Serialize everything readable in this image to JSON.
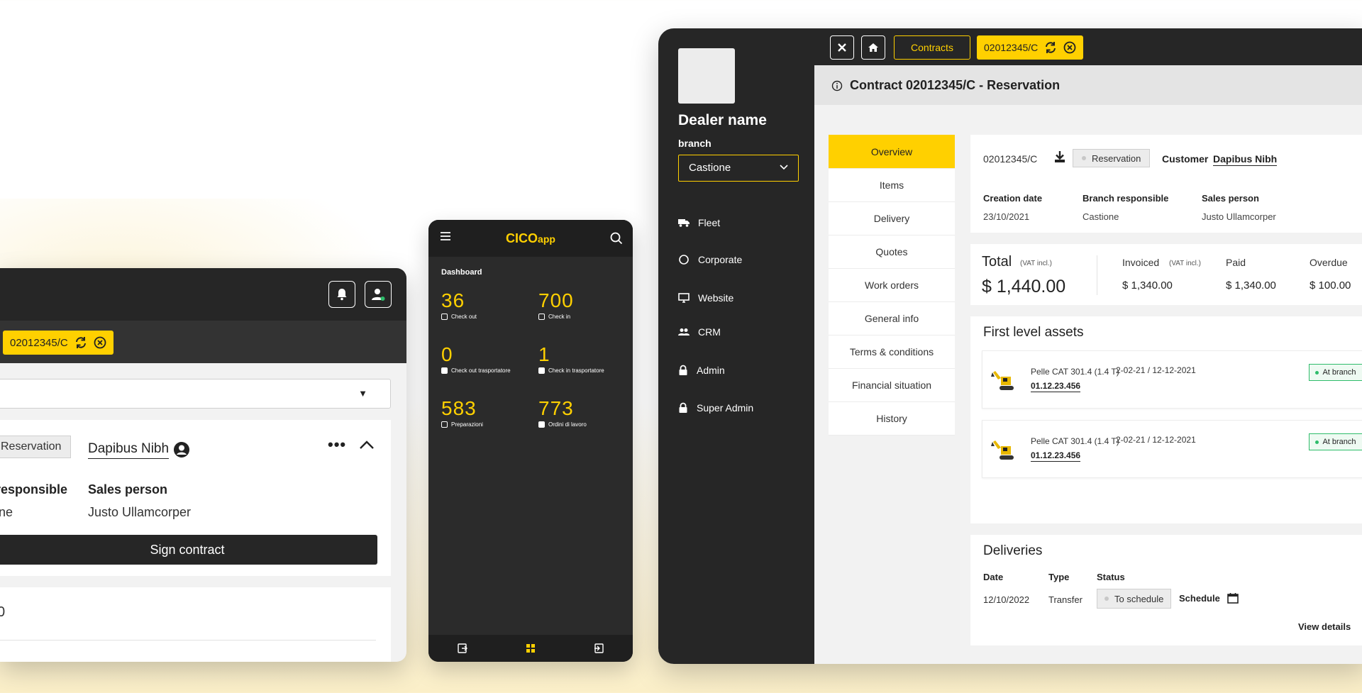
{
  "left_panel": {
    "chip_contract": "02012345/C",
    "reservation": "Reservation",
    "customer": "Dapibus Nibh",
    "more": "•••",
    "branch_responsible_label": "responsible",
    "sales_person_label": "Sales person",
    "branch_value": "ne",
    "sales_person_value": "Justo Ullamcorper",
    "sign_contract": "Sign contract",
    "partial_number": "0"
  },
  "phone": {
    "brand_main": "CICO",
    "brand_sub": "app",
    "dashboard": "Dashboard",
    "stats": [
      {
        "value": "36",
        "label": "Check out"
      },
      {
        "value": "700",
        "label": "Check in"
      },
      {
        "value": "0",
        "label": "Check out trasportatore"
      },
      {
        "value": "1",
        "label": "Check in trasportatore"
      },
      {
        "value": "583",
        "label": "Preparazioni"
      },
      {
        "value": "773",
        "label": "Ordini di lavoro"
      }
    ]
  },
  "app": {
    "dealer_name": "Dealer name",
    "branch_label": "branch",
    "branch_value": "Castione",
    "nav": [
      "Fleet",
      "Corporate",
      "Website",
      "CRM",
      "Admin",
      "Super Admin"
    ],
    "topbar": {
      "contracts": "Contracts",
      "contract_chip": "02012345/C"
    },
    "title": "Contract 02012345/C - Reservation",
    "tabs": [
      "Overview",
      "Items",
      "Delivery",
      "Quotes",
      "Work orders",
      "General info",
      "Terms & conditions",
      "Financial situation",
      "History"
    ],
    "info": {
      "contract_no": "02012345/C",
      "status": "Reservation",
      "customer_label": "Customer",
      "customer": "Dapibus Nibh",
      "creation_date_label": "Creation date",
      "creation_date": "23/10/2021",
      "branch_resp_label": "Branch responsible",
      "branch_resp": "Castione",
      "sales_person_label": "Sales person",
      "sales_person": "Justo Ullamcorper"
    },
    "totals": {
      "total_label": "Total",
      "vat": "(VAT incl.)",
      "total_value": "$ 1,440.00",
      "invoiced_label": "Invoiced",
      "invoiced_value": "$ 1,340.00",
      "paid_label": "Paid",
      "paid_value": "$ 1,340.00",
      "overdue_label": "Overdue",
      "overdue_value": "$ 100.00"
    },
    "assets": {
      "title": "First level assets",
      "rows": [
        {
          "name": "Pelle CAT 301.4 (1.4 T)",
          "dates": "2-02-21 / 12-12-2021",
          "code": "01.12.23.456",
          "status": "At branch"
        },
        {
          "name": "Pelle CAT 301.4 (1.4 T)",
          "dates": "2-02-21 / 12-12-2021",
          "code": "01.12.23.456",
          "status": "At branch"
        }
      ]
    },
    "deliveries": {
      "title": "Deliveries",
      "date_label": "Date",
      "type_label": "Type",
      "status_label": "Status",
      "date": "12/10/2022",
      "type": "Transfer",
      "status": "To schedule",
      "schedule": "Schedule",
      "view_details": "View details"
    }
  }
}
